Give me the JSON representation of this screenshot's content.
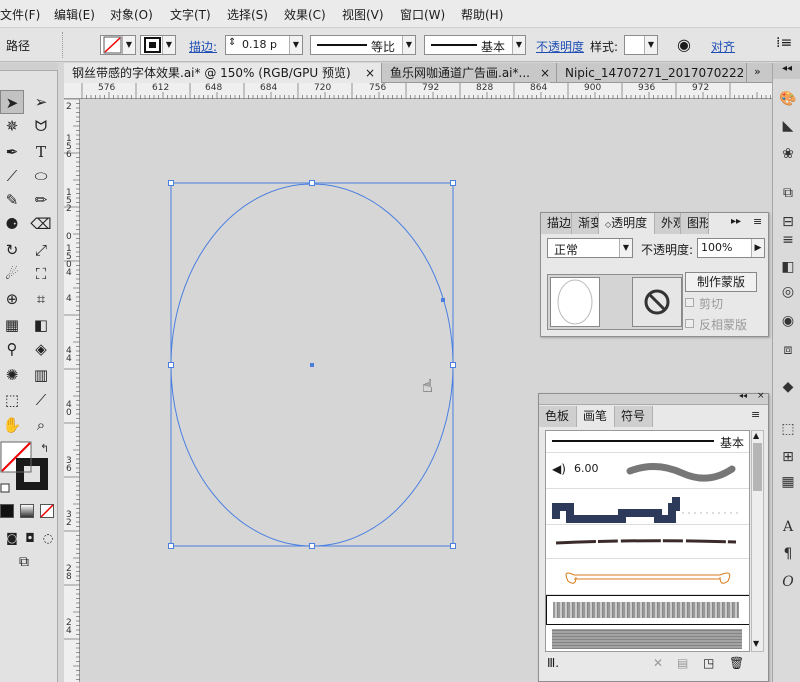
{
  "menu": [
    "文件(F)",
    "编辑(E)",
    "对象(O)",
    "文字(T)",
    "选择(S)",
    "效果(C)",
    "视图(V)",
    "窗口(W)",
    "帮助(H)"
  ],
  "control": {
    "object_type": "路径",
    "stroke_label": "描边:",
    "stroke_value": "0.18 p",
    "profile_label": "等比",
    "brush_label": "基本",
    "opacity_link": "不透明度",
    "style_label": "样式:",
    "align_link": "对齐"
  },
  "tabs": [
    "钢丝带感的字体效果.ai* @ 150% (RGB/GPU 预览)",
    "鱼乐网咖通道广告画.ai*...",
    "Nipic_14707271_2017070222"
  ],
  "ruler": {
    "h_labels": [
      "576",
      "612",
      "648",
      "684",
      "720",
      "756",
      "792",
      "828",
      "864",
      "900",
      "936",
      "972"
    ],
    "v_labels": [
      "2",
      "1 5 6",
      "1 5 2",
      "0",
      "1 5 0 4",
      "4",
      "4 8",
      "4 4",
      "4 0",
      "3 6",
      "3 2",
      "2 8",
      "2 4"
    ]
  },
  "transparency_panel": {
    "tabs": [
      "描边",
      "渐变",
      "透明度",
      "外观",
      "图形"
    ],
    "blend_mode": "正常",
    "opacity_label": "不透明度:",
    "opacity_value": "100%",
    "make_mask_button": "制作蒙版",
    "clip_label": "剪切",
    "invert_label": "反相蒙版"
  },
  "brush_panel": {
    "tabs": [
      "色板",
      "画笔",
      "符号"
    ],
    "basic_label": "基本",
    "size_value": "6.00"
  },
  "colors": {
    "selection": "#4a7fe0",
    "accent_orange": "#d97a1a"
  }
}
